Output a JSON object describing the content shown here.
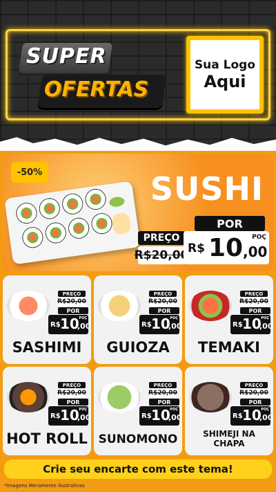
{
  "header": {
    "badge_top": "SUPER",
    "badge_bottom": "OFERTAS",
    "logo_line1": "Sua Logo",
    "logo_line2": "Aqui"
  },
  "hero": {
    "discount": "-50%",
    "title": "SUSHI",
    "por": "POR",
    "preco": "PREÇO",
    "old_price": "R$20,00",
    "new_currency": "R$",
    "new_int": "10",
    "new_dec": ",00",
    "unit": "POÇ"
  },
  "products": [
    {
      "name": "SASHIMI",
      "preco": "PREÇO",
      "old": "R$20,00",
      "por": "POR",
      "cur": "R$",
      "int": "10",
      "dec": ",00",
      "unit": "POÇ"
    },
    {
      "name": "GUIOZA",
      "preco": "PREÇO",
      "old": "R$20,00",
      "por": "POR",
      "cur": "R$",
      "int": "10",
      "dec": ",00",
      "unit": "POÇ"
    },
    {
      "name": "TEMAKI",
      "preco": "PREÇO",
      "old": "R$20,00",
      "por": "POR",
      "cur": "R$",
      "int": "10",
      "dec": ",00",
      "unit": "POÇ"
    },
    {
      "name": "HOT ROLL",
      "preco": "PREÇO",
      "old": "R$20,00",
      "por": "POR",
      "cur": "R$",
      "int": "10",
      "dec": ",00",
      "unit": "POÇ"
    },
    {
      "name": "SUNOMONO",
      "preco": "PREÇO",
      "old": "R$20,00",
      "por": "POR",
      "cur": "R$",
      "int": "10",
      "dec": ",00",
      "unit": "POÇ"
    },
    {
      "name": "SHIMEJI NA CHAPA",
      "preco": "PREÇO",
      "old": "R$20,00",
      "por": "POR",
      "cur": "R$",
      "int": "10",
      "dec": ",00",
      "unit": "POÇ"
    }
  ],
  "cta": "Crie seu encarte com este tema!",
  "disclaimer": "*Imagens Meramente Ilustrativas",
  "colors": {
    "accent_orange": "#f7901e",
    "neon_yellow": "#ffc400",
    "dark": "#111111"
  }
}
